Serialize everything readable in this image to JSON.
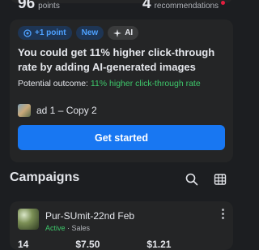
{
  "top_stats": {
    "left_value": "96",
    "left_label": "points",
    "right_value": "4",
    "right_label": "recommendations"
  },
  "recommendation": {
    "pill_point": "+1 point",
    "pill_new": "New",
    "pill_ai": "AI",
    "headline": "You could get 11% higher click-through rate by adding AI-generated images",
    "outcome_label": "Potential outcome:",
    "outcome_value": "11% higher click-through rate",
    "ad_name": "ad 1 – Copy 2",
    "cta_label": "Get started"
  },
  "campaigns": {
    "title": "Campaigns",
    "items": [
      {
        "name": "Pur-SUmit-22nd Feb",
        "status": "Active",
        "objective": "Sales",
        "metrics": [
          "14",
          "$7.50",
          "$1.21"
        ]
      }
    ]
  },
  "colors": {
    "accent": "#1877f2",
    "positive": "#3ec86b",
    "alert": "#e41e3f"
  }
}
